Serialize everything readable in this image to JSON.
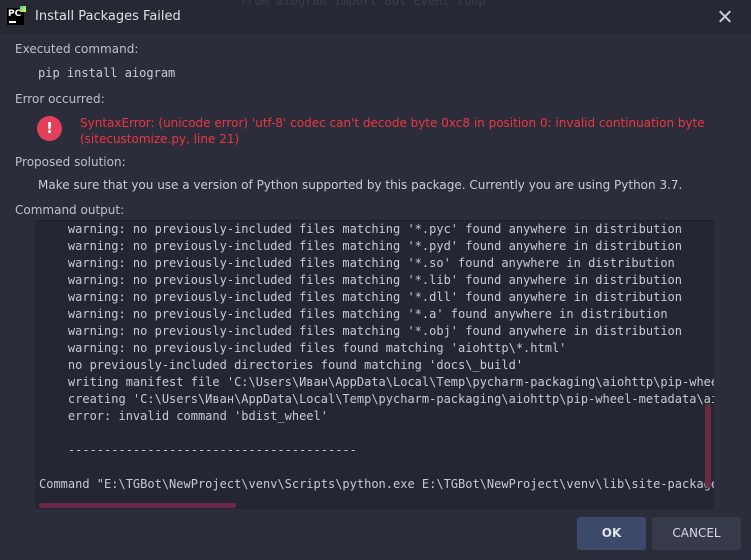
{
  "window": {
    "title": "Install Packages Failed",
    "app_icon_text": "PC",
    "background_ghost_text": "from aiogram import Bot Event loop"
  },
  "executed": {
    "label": "Executed command:",
    "command": "pip install aiogram"
  },
  "error": {
    "label": "Error occurred:",
    "icon": "error-icon",
    "message": "SyntaxError: (unicode error) 'utf-8' codec can't decode byte 0xc8 in position 0: invalid continuation byte (sitecustomize.py, line 21)"
  },
  "solution": {
    "label": "Proposed solution:",
    "text": "Make sure that you use a version of Python supported by this package. Currently you are using Python 3.7."
  },
  "output": {
    "label": "Command output:",
    "lines": [
      "    warning: no previously-included files matching '*.pyc' found anywhere in distribution",
      "    warning: no previously-included files matching '*.pyd' found anywhere in distribution",
      "    warning: no previously-included files matching '*.so' found anywhere in distribution",
      "    warning: no previously-included files matching '*.lib' found anywhere in distribution",
      "    warning: no previously-included files matching '*.dll' found anywhere in distribution",
      "    warning: no previously-included files matching '*.a' found anywhere in distribution",
      "    warning: no previously-included files matching '*.obj' found anywhere in distribution",
      "    warning: no previously-included files found matching 'aiohttp\\*.html'",
      "    no previously-included directories found matching 'docs\\_build'",
      "    writing manifest file 'C:\\Users\\Иван\\AppData\\Local\\Temp\\pycharm-packaging\\aiohttp\\pip-wheel-m",
      "    creating 'C:\\Users\\Иван\\AppData\\Local\\Temp\\pycharm-packaging\\aiohttp\\pip-wheel-metadata\\aioh",
      "    error: invalid command 'bdist_wheel'",
      "",
      "    ----------------------------------------",
      "",
      "Command \"E:\\TGBot\\NewProject\\venv\\Scripts\\python.exe E:\\TGBot\\NewProject\\venv\\lib\\site-packages\\p"
    ]
  },
  "buttons": {
    "ok": "OK",
    "cancel": "CANCEL"
  },
  "colors": {
    "background": "#2b2d3a",
    "error": "#ee3542",
    "ok_button": "#3c4968",
    "scrollbar": "#6a2a45"
  }
}
